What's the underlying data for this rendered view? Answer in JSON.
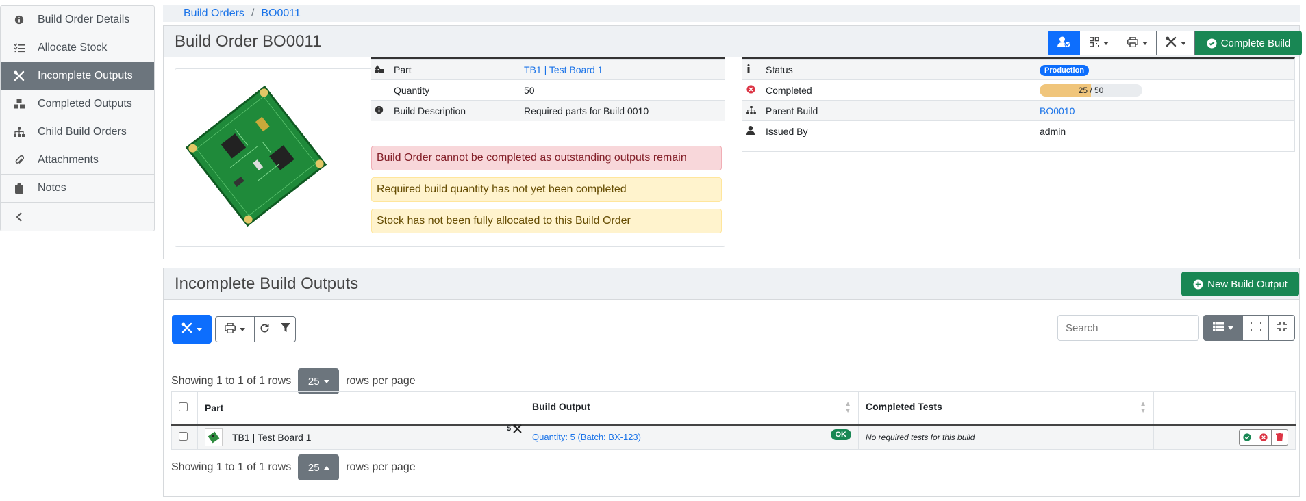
{
  "sidebar": {
    "items": [
      {
        "label": "Build Order Details",
        "icon": "info-circle-icon"
      },
      {
        "label": "Allocate Stock",
        "icon": "list-check-icon"
      },
      {
        "label": "Incomplete Outputs",
        "icon": "tools-icon",
        "active": true
      },
      {
        "label": "Completed Outputs",
        "icon": "boxes-icon"
      },
      {
        "label": "Child Build Orders",
        "icon": "sitemap-icon"
      },
      {
        "label": "Attachments",
        "icon": "paperclip-icon"
      },
      {
        "label": "Notes",
        "icon": "clipboard-icon"
      }
    ],
    "collapse_icon": "chevron-left-icon"
  },
  "breadcrumb": {
    "root": "Build Orders",
    "sep": "/",
    "current": "BO0011"
  },
  "header": {
    "title": "Build Order BO0011",
    "complete_build_label": "Complete Build"
  },
  "details": {
    "part_label": "Part",
    "part_value": "TB1 | Test Board 1",
    "quantity_label": "Quantity",
    "quantity_value": "50",
    "description_label": "Build Description",
    "description_value": "Required parts for Build 0010"
  },
  "alerts": {
    "outstanding": "Build Order cannot be completed as outstanding outputs remain",
    "quantity": "Required build quantity has not yet been completed",
    "allocation": "Stock has not been fully allocated to this Build Order"
  },
  "status": {
    "status_label": "Status",
    "status_badge": "Production",
    "completed_label": "Completed",
    "completed_text": "25 / 50",
    "completed_fraction": 0.5,
    "parent_label": "Parent Build",
    "parent_value": "BO0010",
    "issued_label": "Issued By",
    "issued_value": "admin"
  },
  "outputs": {
    "title": "Incomplete Build Outputs",
    "new_output_label": "New Build Output",
    "search_placeholder": "Search",
    "showing_text": "Showing 1 to 1 of 1 rows",
    "page_size": "25",
    "rows_per_page": "rows per page",
    "columns": [
      "Part",
      "Build Output",
      "Completed Tests"
    ],
    "rows": [
      {
        "part": "TB1 | Test Board 1",
        "part_icons": "$",
        "build_output": "Quantity: 5 (Batch: BX-123)",
        "status_badge": "OK",
        "tests": "No required tests for this build"
      }
    ]
  },
  "colors": {
    "primary": "#0d6efd",
    "success": "#198754",
    "link": "#1a73e8",
    "progress": "#f0c57b"
  }
}
